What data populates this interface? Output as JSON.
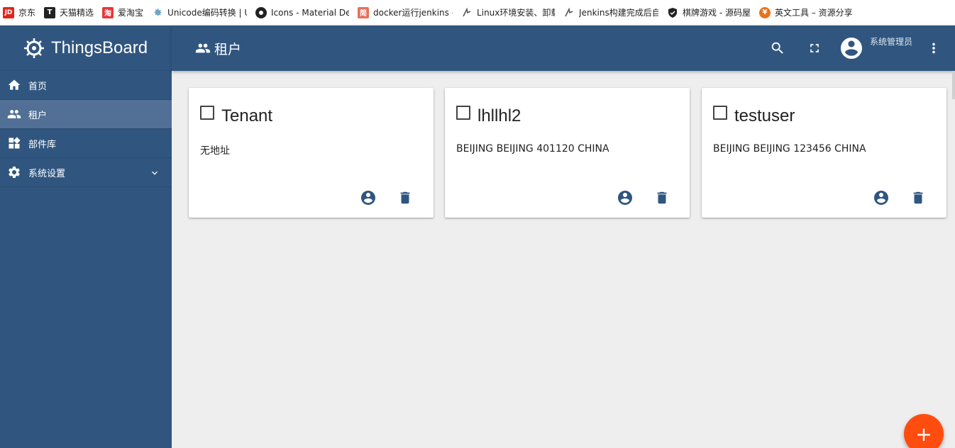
{
  "bookmarks": [
    {
      "label": "京东",
      "icon": "jd-icon",
      "icon_text": "JD",
      "color": "#e1251b"
    },
    {
      "label": "天猫精选",
      "icon": "tmall-icon",
      "icon_text": "T",
      "color": "#222222"
    },
    {
      "label": "爱淘宝",
      "icon": "taobao-icon",
      "icon_text": "淘",
      "color": "#e4393c"
    },
    {
      "label": "Unicode编码转换 | U",
      "icon": "gear-icon",
      "icon_text": "",
      "color": "#6ba5c8"
    },
    {
      "label": "Icons - Material De",
      "icon": "github-icon",
      "icon_text": "",
      "color": "#222222"
    },
    {
      "label": "docker运行jenkins -",
      "icon": "jianshu-icon",
      "icon_text": "简",
      "color": "#ea6f5a"
    },
    {
      "label": "Linux环境安装、卸载",
      "icon": "csdn-icon",
      "icon_text": "",
      "color": "#555555"
    },
    {
      "label": "Jenkins构建完成后自",
      "icon": "csdn-icon",
      "icon_text": "",
      "color": "#555555"
    },
    {
      "label": "棋牌游戏 - 源码屋",
      "icon": "shield-icon",
      "icon_text": "",
      "color": "#222222"
    },
    {
      "label": "英文工具 – 资源分享",
      "icon": "yen-icon",
      "icon_text": "¥",
      "color": "#e8731c"
    }
  ],
  "app": {
    "brand": "ThingsBoard",
    "page_title": "租户",
    "user_role": "系统管理员"
  },
  "sidebar": {
    "items": [
      {
        "label": "首页",
        "icon": "home-icon",
        "active": false
      },
      {
        "label": "租户",
        "icon": "people-icon",
        "active": true
      },
      {
        "label": "部件库",
        "icon": "widgets-icon",
        "active": false
      },
      {
        "label": "系统设置",
        "icon": "settings-icon",
        "active": false,
        "expandable": true
      }
    ]
  },
  "tenants": [
    {
      "title": "Tenant",
      "address": "无地址"
    },
    {
      "title": "lhllhl2",
      "address": "BEIJING BEIJING 401120 CHINA"
    },
    {
      "title": "testuser",
      "address": "BEIJING BEIJING 123456 CHINA"
    }
  ],
  "fab": {
    "label": "+"
  },
  "colors": {
    "primary": "#305680",
    "primary_active": "#527095",
    "accent": "#ff4d10",
    "background": "#eeeeee",
    "card_icon": "#305680"
  }
}
